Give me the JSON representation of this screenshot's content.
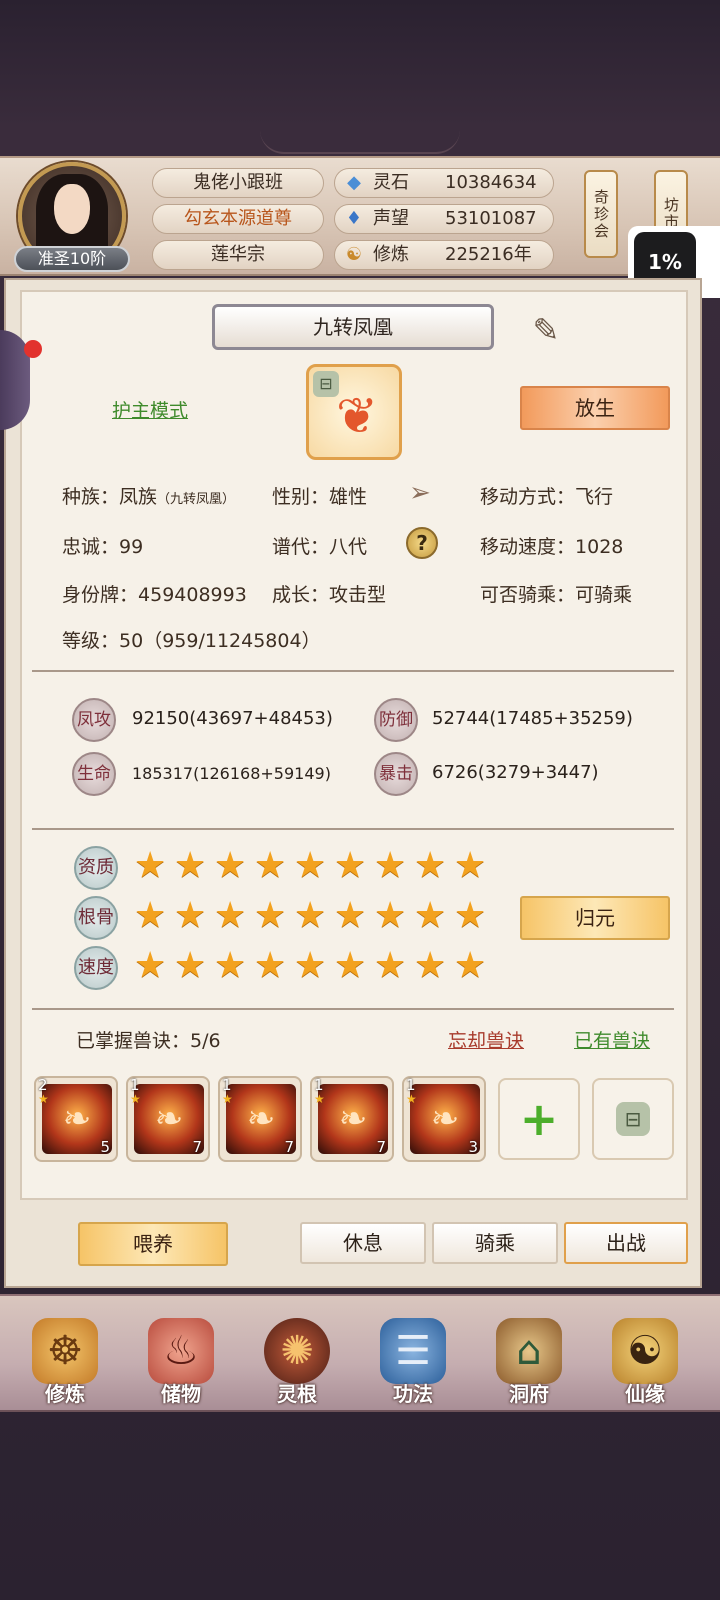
{
  "header": {
    "rank_badge": "准圣10阶",
    "names": [
      "鬼佬小跟班",
      "勾玄本源道尊",
      "莲华宗"
    ],
    "resources": [
      {
        "icon": "spirit-stone-icon",
        "label": "灵石",
        "value": "10384634"
      },
      {
        "icon": "prestige-icon",
        "label": "声望",
        "value": "53101087"
      },
      {
        "icon": "cultivation-icon",
        "label": "修炼",
        "value": "225216年"
      }
    ],
    "treasure_fair": "奇珍会",
    "market": "坊市",
    "percent_badge": "1%",
    "colors": {
      "title_orange": "#b8561c"
    }
  },
  "pet": {
    "name": "九转凤凰",
    "guard_mode": "护主模式",
    "release_label": "放生",
    "race_label": "种族：",
    "race": "凤族",
    "race_sub": "（九转凤凰）",
    "gender_label": "性别：",
    "gender": "雄性",
    "move_mode_label": "移动方式：",
    "move_mode": "飞行",
    "loyalty_label": "忠诚：",
    "loyalty": "99",
    "generation_label": "谱代：",
    "generation": "八代",
    "move_speed_label": "移动速度：",
    "move_speed": "1028",
    "id_label": "身份牌：",
    "id": "459408993",
    "growth_label": "成长：",
    "growth": "攻击型",
    "rideable_label": "可否骑乘：",
    "rideable": "可骑乘",
    "level_label": "等级：",
    "level": "50（959/11245804）"
  },
  "stats": [
    {
      "badge": "凤攻",
      "value": "92150(43697+48453)"
    },
    {
      "badge": "防御",
      "value": "52744(17485+35259)"
    },
    {
      "badge": "生命",
      "value": "185317(126168+59149)"
    },
    {
      "badge": "暴击",
      "value": "6726(3279+3447)"
    }
  ],
  "aptitudes": [
    {
      "label": "资质",
      "stars": 9
    },
    {
      "label": "根骨",
      "stars": 9
    },
    {
      "label": "速度",
      "stars": 9
    }
  ],
  "restore_label": "归元",
  "skills": {
    "mastered": "已掌握兽诀：5/6",
    "forget": "忘却兽诀",
    "owned": "已有兽诀",
    "slots": [
      {
        "tier": "2",
        "level": "5"
      },
      {
        "tier": "1",
        "level": "7"
      },
      {
        "tier": "1",
        "level": "7"
      },
      {
        "tier": "1",
        "level": "7"
      },
      {
        "tier": "1",
        "level": "3"
      }
    ],
    "add_glyph": "+",
    "lock_glyph": "🔒"
  },
  "actions": {
    "feed": "喂养",
    "rest": "休息",
    "ride": "骑乘",
    "battle": "出战"
  },
  "nav": [
    {
      "label": "修炼",
      "icon": "cultivator-icon"
    },
    {
      "label": "储物",
      "icon": "storage-bag-icon"
    },
    {
      "label": "灵根",
      "icon": "spirit-root-icon"
    },
    {
      "label": "功法",
      "icon": "scripture-book-icon"
    },
    {
      "label": "洞府",
      "icon": "cave-abode-icon"
    },
    {
      "label": "仙缘",
      "icon": "gourd-icon"
    }
  ]
}
